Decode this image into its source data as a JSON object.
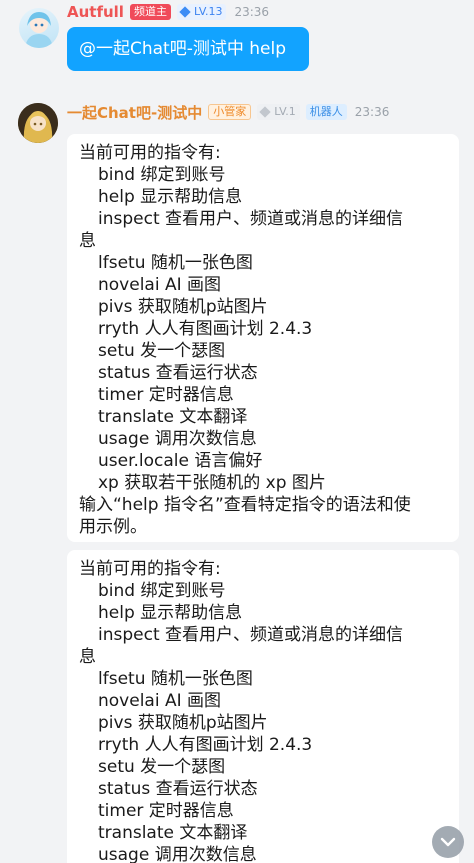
{
  "message1": {
    "username": "Autfull",
    "role_badge": "频道主",
    "level": "LV.13",
    "time": "23:36",
    "text": "@一起Chat吧-测试中 help"
  },
  "message2": {
    "username": "一起Chat吧-测试中",
    "role_badge": "小管家",
    "level": "LV.1",
    "bot_badge": "机器人",
    "time": "23:36"
  },
  "help_text": {
    "header": "当前可用的指令有:",
    "commands": [
      "bind  绑定到账号",
      "help  显示帮助信息",
      "inspect  查看用户、频道或消息的详细信",
      "lfsetu  随机一张色图",
      "novelai  AI 画图",
      "pivs  获取随机p站图片",
      "rryth  人人有图画计划 2.4.3",
      "setu  发一个瑟图",
      "status  查看运行状态",
      "timer  定时器信息",
      "translate  文本翻译",
      "usage  调用次数信息",
      "user.locale  语言偏好",
      "xp  获取若干张随机的 xp 图片"
    ],
    "inspect_wrap": "息",
    "footer_line1": "输入“help 指令名”查看特定指令的语法和使",
    "footer_line2": "用示例。"
  },
  "colors": {
    "my_bubble": "#12a3ff",
    "username_1": "#ee5555",
    "username_2": "#e58a32",
    "background": "#f2f3f5"
  },
  "icons": {
    "level_diamond": "diamond-icon",
    "scroll_down": "chevron-down-icon"
  }
}
